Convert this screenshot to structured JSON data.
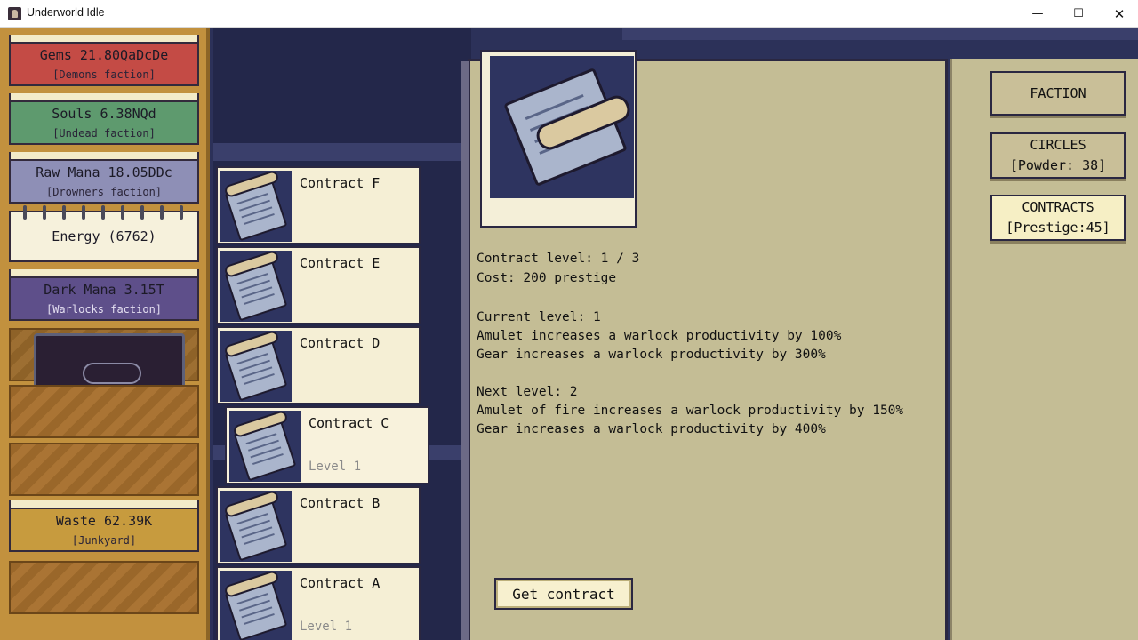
{
  "window": {
    "title": "Underworld Idle",
    "minimize": "—",
    "maximize": "☐",
    "close": "✕"
  },
  "resources": [
    {
      "amount": "Gems 21.80QaDcDe",
      "faction": "[Demons faction]"
    },
    {
      "amount": "Souls 6.38NQd",
      "faction": "[Undead faction]"
    },
    {
      "amount": "Raw Mana 18.05DDc",
      "faction": "[Drowners faction]"
    },
    {
      "amount": "Energy (6762)",
      "faction": ""
    },
    {
      "amount": "Dark Mana 3.15T",
      "faction": "[Warlocks faction]"
    },
    {
      "amount": "Waste 62.39K",
      "faction": "[Junkyard]"
    }
  ],
  "contracts": [
    {
      "name": "Contract F",
      "level": ""
    },
    {
      "name": "Contract E",
      "level": ""
    },
    {
      "name": "Contract D",
      "level": ""
    },
    {
      "name": "Contract C",
      "level": "Level 1"
    },
    {
      "name": "Contract B",
      "level": ""
    },
    {
      "name": "Contract A",
      "level": "Level 1"
    }
  ],
  "detail": {
    "contract_level": "Contract level: 1 / 3",
    "cost": "Cost: 200 prestige",
    "current_level": "Current level: 1",
    "current_line1": "Amulet increases a warlock productivity by 100%",
    "current_line2": "Gear increases a warlock productivity by 300%",
    "next_level": "Next level: 2",
    "next_line1": "Amulet of fire increases a warlock productivity by 150%",
    "next_line2": "Gear increases a warlock productivity by 400%",
    "get_button": "Get contract"
  },
  "nav": {
    "faction": "FACTION",
    "circles_title": "CIRCLES",
    "circles_sub": "[Powder: 38]",
    "contracts_title": "CONTRACTS",
    "contracts_sub": "[Prestige:45]"
  }
}
